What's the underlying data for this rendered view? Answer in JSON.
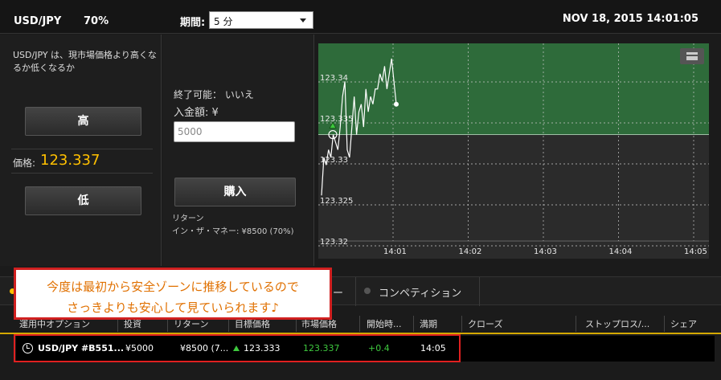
{
  "header": {
    "pair": "USD/JPY",
    "payout_pct": "70%",
    "period_label": "期間:",
    "period_value": "5 分",
    "datetime": "NOV 18, 2015 14:01:05"
  },
  "left_panel": {
    "description": "USD/JPY は、現市場価格より高くなるか低くなるか",
    "high_button": "高",
    "price_label": "価格:",
    "price_value": "123.337",
    "low_button": "低"
  },
  "middle_panel": {
    "end_possible": "終了可能： いいえ",
    "deposit_label": "入金額: ¥",
    "amount_placeholder": "5000",
    "buy_button": "購入",
    "return_label": "リターン",
    "in_the_money": "イン・ザ・マネー: ¥8500 (70%)"
  },
  "chart_data": {
    "type": "line",
    "y_ticks": [
      "123.34",
      "123.335",
      "123.33",
      "123.325",
      "123.32"
    ],
    "x_ticks": [
      "14:01",
      "14:02",
      "14:03",
      "14:04",
      "14:05"
    ],
    "ylim": [
      123.319,
      123.345
    ],
    "strike_price": 123.333,
    "strike_zone_color": "#2e6b3a",
    "line_color": "#ffffff",
    "series": [
      {
        "values": [
          123.325,
          123.33,
          123.329,
          123.331,
          123.33,
          123.333,
          123.332,
          123.331,
          123.334,
          123.338,
          123.34,
          123.331,
          123.33,
          123.334,
          123.338,
          123.333,
          123.336,
          123.337,
          123.334,
          123.339,
          123.336,
          123.338,
          123.337,
          123.339,
          123.339,
          123.341,
          123.34,
          123.342,
          123.339,
          123.341,
          123.343,
          123.34,
          123.337
        ]
      }
    ]
  },
  "tabs": {
    "hidden_tab_fragment": "ー",
    "competition": "コンペティション"
  },
  "table": {
    "headers": [
      "運用中オプション",
      "投資",
      "リターン",
      "目標価格",
      "市場価格",
      "開始時...",
      "満期",
      "クローズ",
      "ストップロス/...",
      "シェア"
    ],
    "row": {
      "option": "USD/JPY #B551...",
      "investment": "¥5000",
      "return": "¥8500 (7...",
      "target": "123.333",
      "market": "123.337",
      "change": "+0.4",
      "expiry": "14:05"
    }
  },
  "callout": {
    "line1": "今度は最初から安全ゾーンに推移しているので",
    "line2": "さっきよりも安心して見ていられます♪"
  },
  "colors": {
    "accent": "#ffc000",
    "up": "#3ec93e",
    "highlight_border": "#e02020",
    "callout_text": "#e07000"
  }
}
